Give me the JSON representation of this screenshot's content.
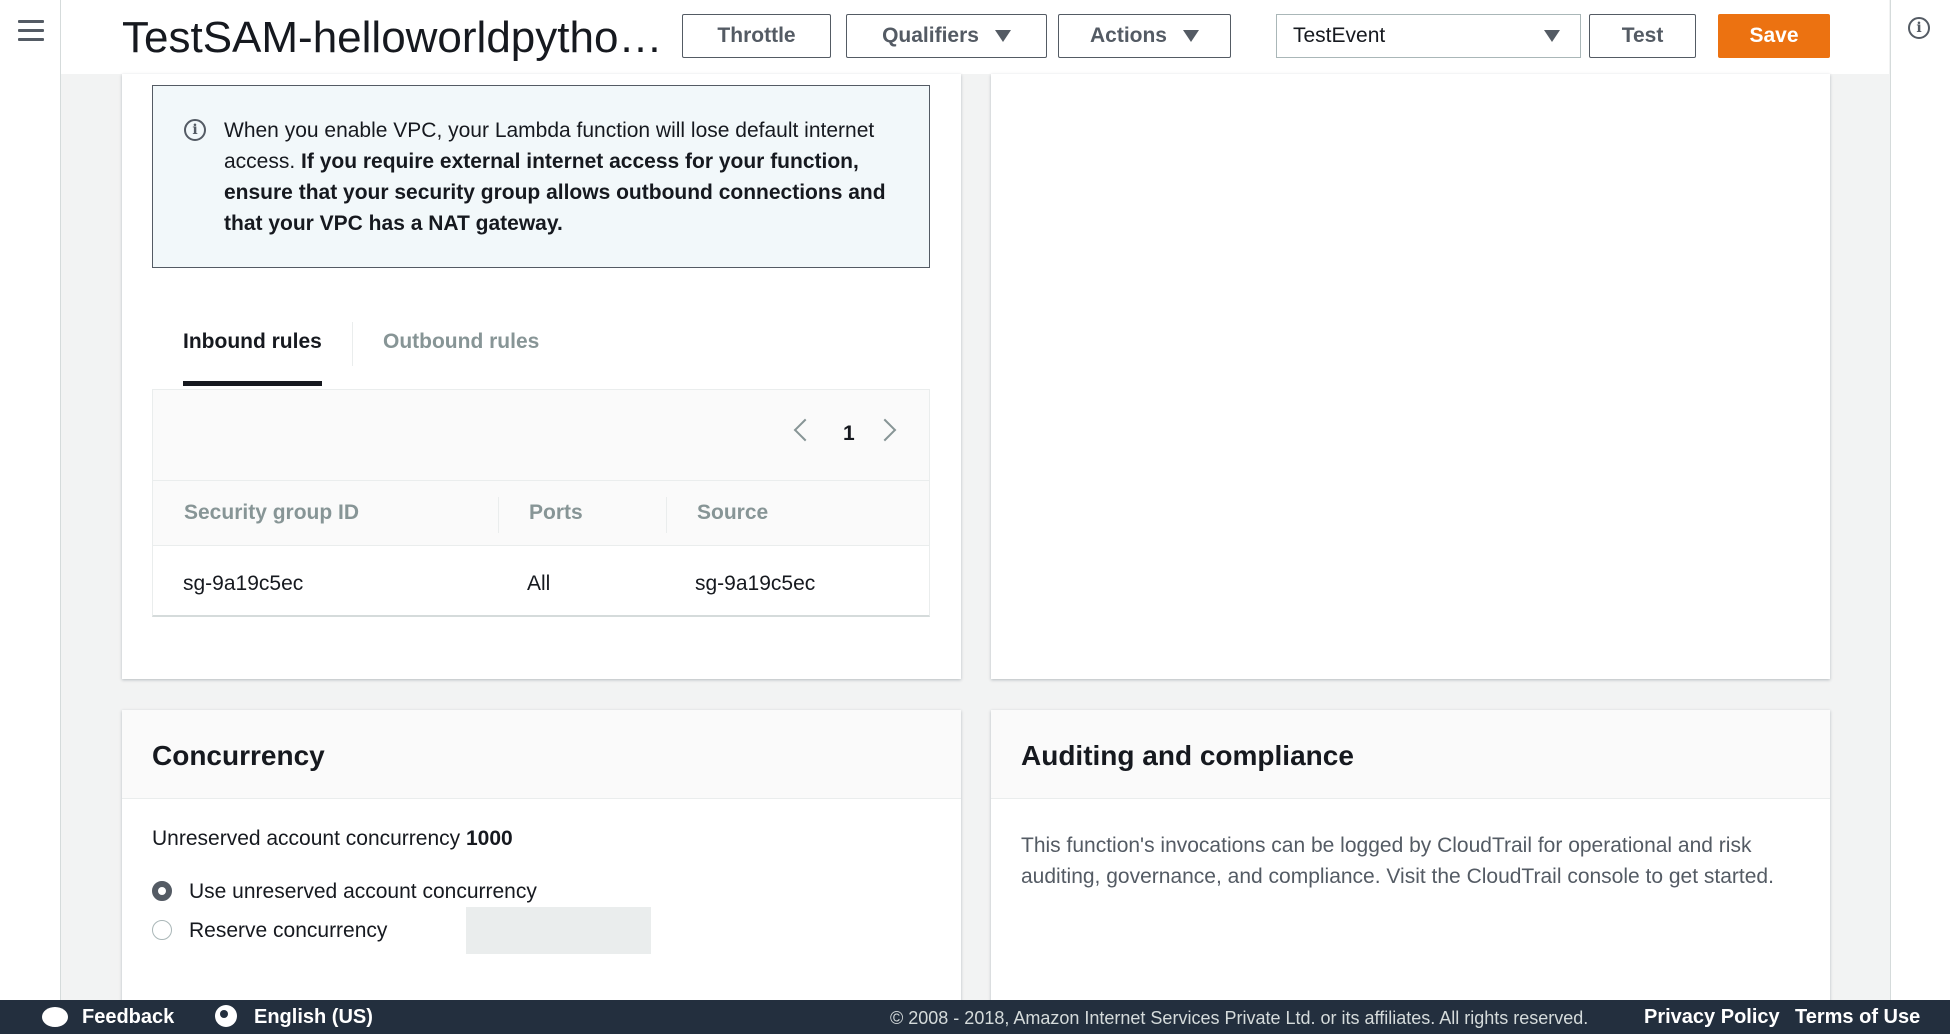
{
  "header": {
    "title": "TestSAM-helloworldpytho…",
    "throttle_label": "Throttle",
    "qualifiers_label": "Qualifiers",
    "actions_label": "Actions",
    "test_event_value": "TestEvent",
    "test_label": "Test",
    "save_label": "Save",
    "accent_color": "#ec7211"
  },
  "vpc": {
    "alert_plain": "When you enable VPC, your Lambda function will lose default internet access. ",
    "alert_bold": "If you require external internet access for your function, ensure that your security group allows outbound connections and that your VPC has a NAT gateway.",
    "tabs": [
      "Inbound rules",
      "Outbound rules"
    ],
    "pager_page": "1",
    "columns": [
      "Security group ID",
      "Ports",
      "Source"
    ],
    "rows": [
      [
        "sg-9a19c5ec",
        "All",
        "sg-9a19c5ec"
      ]
    ]
  },
  "concurrency": {
    "title": "Concurrency",
    "unreserved_label": "Unreserved account concurrency",
    "unreserved_value": "1000",
    "option_unreserved": "Use unreserved account concurrency",
    "option_reserve": "Reserve concurrency"
  },
  "auditing": {
    "title": "Auditing and compliance",
    "text": "This function's invocations can be logged by CloudTrail for operational and risk auditing, governance, and compliance. Visit the CloudTrail console to get started."
  },
  "footer": {
    "feedback": "Feedback",
    "language": "English (US)",
    "copyright": "© 2008 - 2018, Amazon Internet Services Private Ltd. or its affiliates. All rights reserved.",
    "privacy": "Privacy Policy",
    "terms": "Terms of Use"
  }
}
